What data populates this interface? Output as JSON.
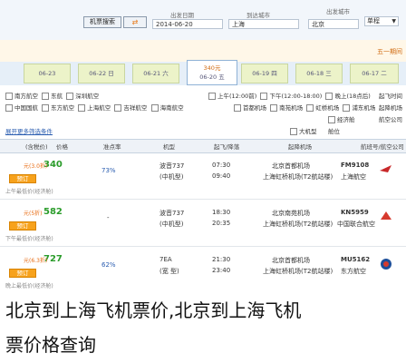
{
  "search": {
    "trip_type_label": "单程",
    "depart_label": "出发城市",
    "arrive_label": "到达城市",
    "date_label": "出发日期",
    "depart_city": "北京",
    "arrive_city": "上海",
    "date_value": "2014-06-20",
    "search_button": "机票搜索",
    "search_top_label": "出发城市",
    "search_top_city": "北京"
  },
  "notice": {
    "text": "五一期间"
  },
  "date_tabs": [
    {
      "label": "06-17 二"
    },
    {
      "label": "06-18 三"
    },
    {
      "label": "06-19 四"
    },
    {
      "label": "06-20 五",
      "sub": "340元",
      "active": true
    },
    {
      "label": "06-21 六"
    },
    {
      "label": "06-22 日"
    },
    {
      "label": "06-23"
    }
  ],
  "filters": {
    "row1_label": "起飞时间",
    "row1": [
      "上午(12:00前)",
      "下午(12:00-18:00)",
      "晚上(18点后)"
    ],
    "row2_label": "起降机场",
    "row2": [
      "首都机场",
      "南苑机场",
      "虹桥机场",
      "浦东机场"
    ],
    "row3_label": "航空公司",
    "row3": [
      "中国国航",
      "东方航空",
      "上海航空",
      "吉祥航空",
      "海南航空",
      "南方航空",
      "东航",
      "深圳航空"
    ],
    "row4_label": "舱位",
    "row4": [
      "经济舱",
      "公务舱"
    ],
    "row5_label": "机型",
    "row5": [
      "大机型",
      "中小机型"
    ],
    "link": "展开更多筛选条件"
  },
  "table_header": {
    "airline": "航班号/航空公司",
    "depart_airport": "起降机场",
    "time": "起飞/降落",
    "type": "机型",
    "punctuality": "准点率",
    "price": "价格",
    "remark": "(含税价)"
  },
  "flights": [
    {
      "flight_no": "FM9108",
      "airline": "上海航空",
      "airports": [
        "北京首都机场",
        "上海虹桥机场(T2航站楼)"
      ],
      "times": [
        "07:30",
        "09:40"
      ],
      "aircraft": [
        "波音737",
        "(中机型)"
      ],
      "punctuality": "73%",
      "price": "340",
      "discount": "元(3.0折)",
      "book_button": "预订",
      "note": "上午最低价(经济舱)"
    },
    {
      "flight_no": "KN5959",
      "airline": "中国联合航空",
      "airports": [
        "北京南苑机场",
        "上海虹桥机场(T2航站楼)"
      ],
      "times": [
        "18:30",
        "20:35"
      ],
      "aircraft": [
        "波音737",
        "(中机型)"
      ],
      "punctuality": "-",
      "price": "582",
      "discount": "元(5折)",
      "book_button": "预订",
      "note": "下午最低价(经济舱)"
    },
    {
      "flight_no": "MU5162",
      "airline": "东方航空",
      "airports": [
        "北京首都机场",
        "上海虹桥机场(T2航站楼)"
      ],
      "times": [
        "21:30",
        "23:40"
      ],
      "aircraft": [
        "7EA",
        "(宽 型)"
      ],
      "punctuality": "62%",
      "price": "727",
      "discount": "元(6.3折)",
      "book_button": "预订",
      "note": "晚上最低价(经济舱)"
    }
  ],
  "caption": {
    "line1": "北京到上海飞机票价,北京到上海飞机",
    "line2": "票价格查询"
  },
  "colors": {
    "accent": "#f7a21c",
    "price_green": "#2b9c2b",
    "tab_bg": "#ecf3c9",
    "header_bg": "#eef2f7"
  }
}
